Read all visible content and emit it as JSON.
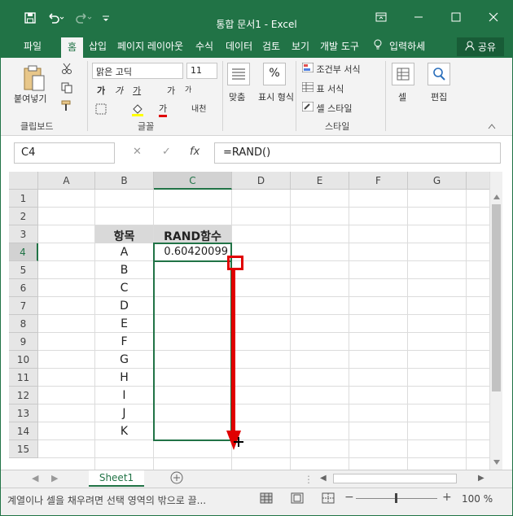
{
  "qat": {
    "save_icon": "save-icon",
    "undo_icon": "undo-icon",
    "redo_icon": "redo-icon",
    "customize_icon": "customize-icon"
  },
  "window": {
    "title": "통합 문서1 - Excel",
    "accent": "#217346"
  },
  "tabs": [
    {
      "label": "파일"
    },
    {
      "label": "홈"
    },
    {
      "label": "삽입"
    },
    {
      "label": "페이지 레이아웃"
    },
    {
      "label": "수식"
    },
    {
      "label": "데이터"
    },
    {
      "label": "검토"
    },
    {
      "label": "보기"
    },
    {
      "label": "개발 도구"
    },
    {
      "label": "입력하세"
    }
  ],
  "share_label": "공유",
  "ribbon": {
    "paste_label": "붙여넣기",
    "clipboard_label": "클립보드",
    "font_name": "맑은 고딕",
    "font_size": "11",
    "font_group_label": "글꼴",
    "bold": "가",
    "italic": "가",
    "underline": "가",
    "grow": "가",
    "shrink": "가",
    "font_color": "가",
    "phonetic": "내천",
    "align_label": "맞춤",
    "number_label": "표시 형식",
    "percent": "%",
    "cond_format_label": "조건부 서식",
    "table_format_label": "표 서식",
    "cell_style_label": "셀 스타일",
    "style_group_label": "스타일",
    "cells_label": "셀",
    "edit_label": "편집"
  },
  "formula_bar": {
    "name_box": "C4",
    "cancel": "✕",
    "enter": "✓",
    "fx": "fx",
    "formula": "=RAND()"
  },
  "columns": [
    "A",
    "B",
    "C",
    "D",
    "E",
    "F",
    "G"
  ],
  "rows": [
    "1",
    "2",
    "3",
    "4",
    "5",
    "6",
    "7",
    "8",
    "9",
    "10",
    "11",
    "12",
    "13",
    "14",
    "15"
  ],
  "table": {
    "header_item": "항목",
    "header_rand": "RAND함수",
    "c4_value": "0.60420099",
    "items": [
      "A",
      "B",
      "C",
      "D",
      "E",
      "F",
      "G",
      "H",
      "I",
      "J",
      "K"
    ]
  },
  "sheet_tab": "Sheet1",
  "status": {
    "message": "계열이나 셀을 채우려면 선택 영역의 밖으로 끌...",
    "zoom": "100 %"
  }
}
